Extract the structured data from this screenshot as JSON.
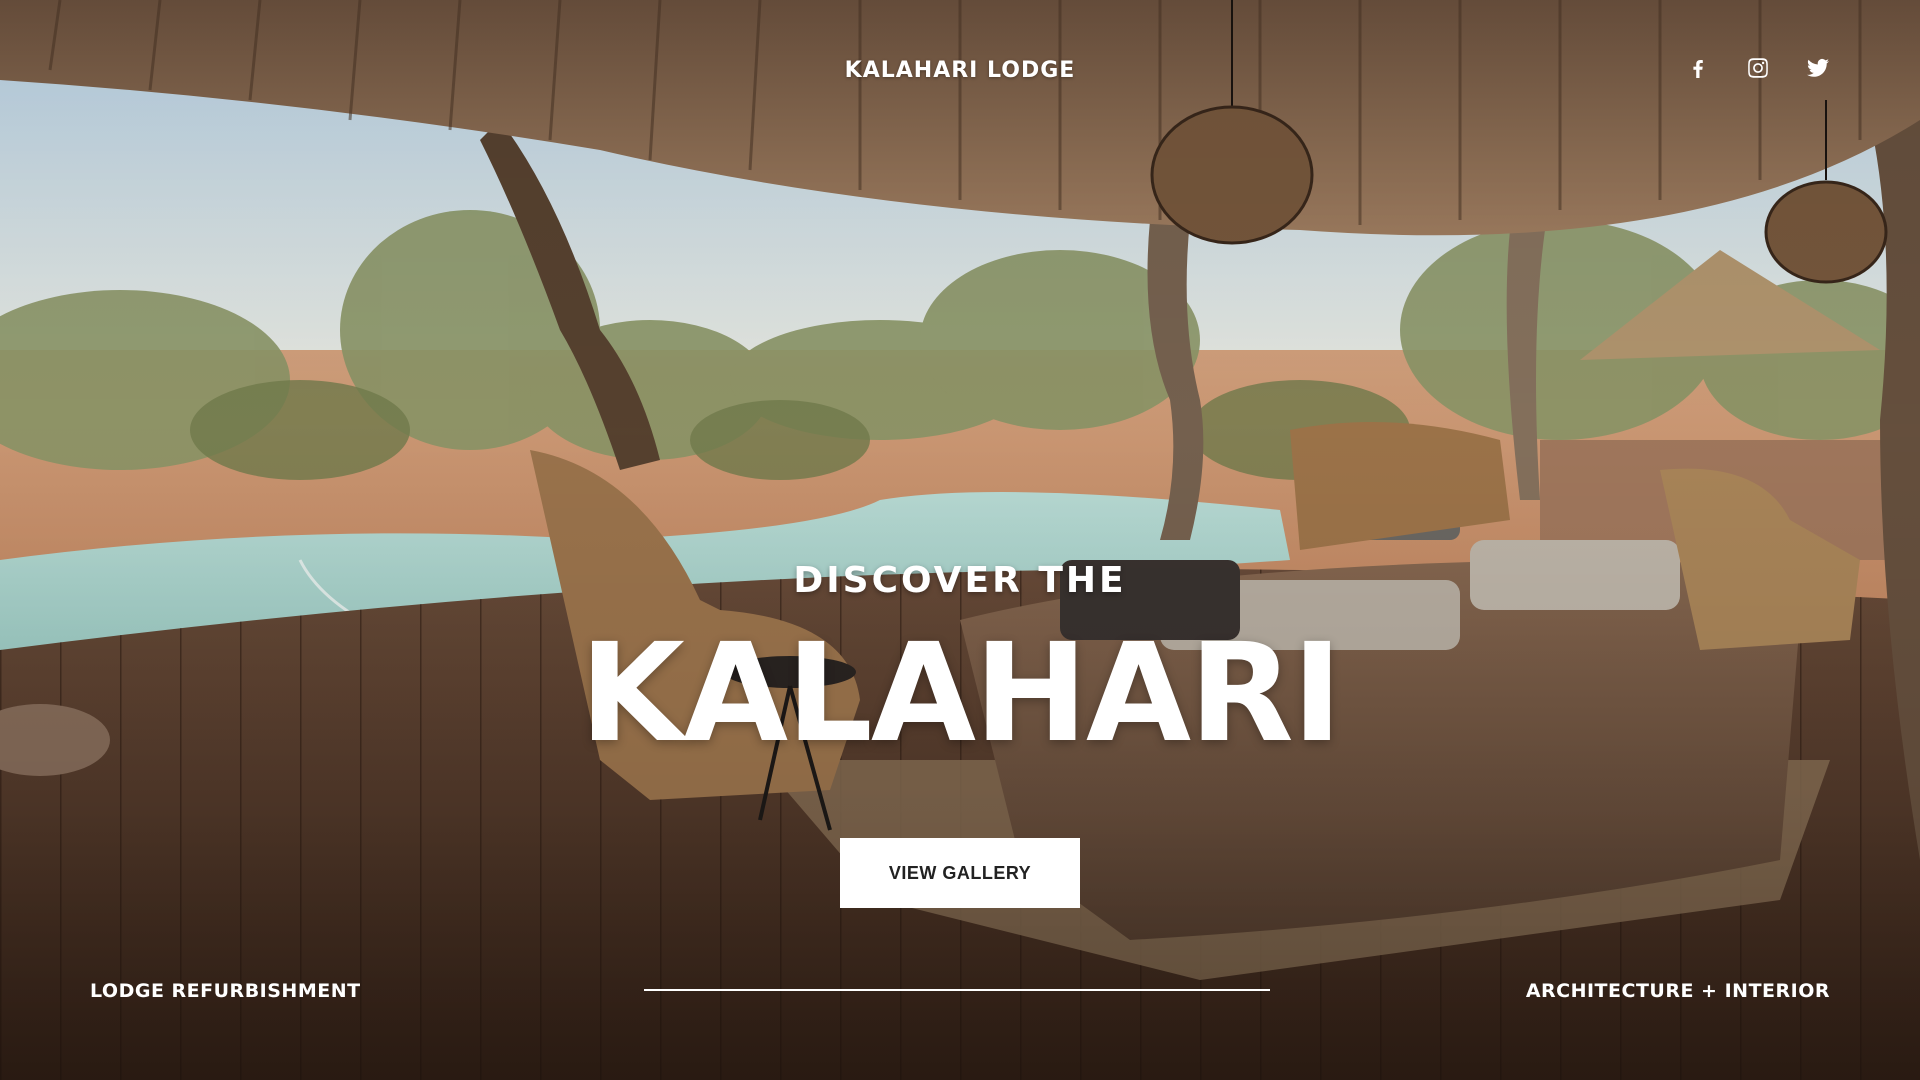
{
  "header": {
    "brand": "KALAHARI LODGE",
    "social": [
      {
        "icon": "facebook-icon"
      },
      {
        "icon": "instagram-icon"
      },
      {
        "icon": "twitter-icon"
      }
    ]
  },
  "hero": {
    "kicker": "DISCOVER THE",
    "title": "KALAHARI",
    "cta_label": "VIEW GALLERY"
  },
  "footer": {
    "left_label": "LODGE REFURBISHMENT",
    "right_label": "ARCHITECTURE + INTERIOR"
  },
  "colors": {
    "text": "#ffffff",
    "button_bg": "#ffffff",
    "button_text": "#222222"
  }
}
